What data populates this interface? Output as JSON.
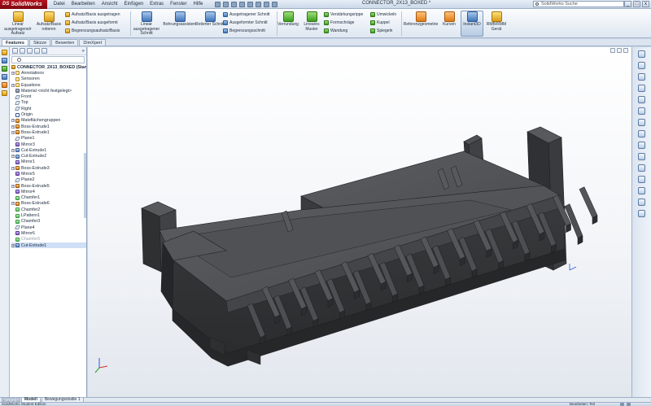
{
  "app": {
    "name": "SolidWorks",
    "doc_title": "CONNECTOR_2X13_BOXED *"
  },
  "menu": [
    "Datei",
    "Bearbeiten",
    "Ansicht",
    "Einfügen",
    "Extras",
    "Fenster",
    "Hilfe"
  ],
  "search": {
    "placeholder": "SolidWorks Suche"
  },
  "window_controls": {
    "minimize": "_",
    "restore": "□",
    "close": "x"
  },
  "ribbon": {
    "linear_boss": "Linear ausgetragene/r Aufsatz",
    "boss_revolve": "Aufsatz/Basis rotieren",
    "boss_swept": "Aufsatz/Basis ausgetragen",
    "boss_loft": "Aufsatz/Basis ausgeformt",
    "boss_boundary": "Begrenzungsaufsatz/Basis",
    "extruded_cut": "Linear ausgetragener Schnitt",
    "hole_wizard": "Bohrungsassistent",
    "revolved_cut": "Rotierter Schnitt",
    "swept_cut": "Ausgetragener Schnitt",
    "lofted_cut": "Ausgeformter Schnitt",
    "boundary_cut": "Begrenzungsschnitt",
    "fillet": "Verrundung",
    "linear_pattern": "Lineares Muster",
    "rib": "Verstärkungsrippe",
    "draft": "Formschräge",
    "shell": "Wandung",
    "wrap": "Umwickeln",
    "dome": "Kuppel",
    "mirror": "Spiegeln",
    "reference_geometry": "Referenzgeometrie",
    "curves": "Kurven",
    "instant3d": "Instant3D",
    "rmb_tools": "RMB/RMM Gerät"
  },
  "tabs": [
    "Features",
    "Skizze",
    "Bewerten",
    "DimXpert"
  ],
  "tree": {
    "root": "CONNECTOR_2X13_BOXED (Standard)",
    "items": [
      {
        "label": "Annotations",
        "icon": "annotations-icon",
        "exp": true
      },
      {
        "label": "Sensoren",
        "icon": "sensor-icon",
        "exp": false
      },
      {
        "label": "Equations",
        "icon": "equations-icon",
        "exp": true
      },
      {
        "label": "Material <nicht festgelegt>",
        "icon": "material-icon",
        "exp": false
      },
      {
        "label": "Front",
        "icon": "plane-icon",
        "exp": false
      },
      {
        "label": "Top",
        "icon": "plane-icon",
        "exp": false
      },
      {
        "label": "Right",
        "icon": "plane-icon",
        "exp": false
      },
      {
        "label": "Origin",
        "icon": "origin-icon",
        "exp": false
      },
      {
        "label": "Mateflächengruppen",
        "icon": "feature-icon",
        "exp": true
      },
      {
        "label": "Boss-Extrude1",
        "icon": "extrude-icon",
        "exp": true
      },
      {
        "label": "Boss-Extrude1",
        "icon": "extrude-icon",
        "exp": true
      },
      {
        "label": "Plane1",
        "icon": "plane-icon",
        "exp": false
      },
      {
        "label": "Mirror3",
        "icon": "mirror-icon",
        "exp": false
      },
      {
        "label": "Cut-Extrude1",
        "icon": "cut-icon",
        "exp": true
      },
      {
        "label": "Cut-Extrude2",
        "icon": "cut-icon",
        "exp": true
      },
      {
        "label": "Mirror1",
        "icon": "mirror-icon",
        "exp": false
      },
      {
        "label": "Boss-Extrude3",
        "icon": "extrude-icon",
        "exp": true
      },
      {
        "label": "Mirror5",
        "icon": "mirror-icon",
        "exp": false
      },
      {
        "label": "Plane2",
        "icon": "plane-icon",
        "exp": false
      },
      {
        "label": "Boss-Extrude5",
        "icon": "extrude-icon",
        "exp": true
      },
      {
        "label": "Mirror4",
        "icon": "mirror-icon",
        "exp": false
      },
      {
        "label": "Chamfer1",
        "icon": "chamfer-icon",
        "exp": false
      },
      {
        "label": "Boss-Extrude6",
        "icon": "extrude-icon",
        "exp": true
      },
      {
        "label": "Chamfer2",
        "icon": "chamfer-icon",
        "exp": false
      },
      {
        "label": "LPattern1",
        "icon": "pattern-icon",
        "exp": false
      },
      {
        "label": "Chamfer3",
        "icon": "chamfer-icon",
        "exp": false
      },
      {
        "label": "Plane4",
        "icon": "plane-icon",
        "exp": false
      },
      {
        "label": "Mirror6",
        "icon": "mirror-icon",
        "exp": false
      },
      {
        "label": "Chamfer5",
        "icon": "chamfer-icon",
        "exp": false,
        "suppressed": true
      },
      {
        "label": "Cut-Extrude1",
        "icon": "cut-icon",
        "exp": true,
        "selected": true
      }
    ]
  },
  "bottom_tabs": [
    "Modell",
    "Bewegungsstudie 1"
  ],
  "status": {
    "left": "SolidWorks Student Edition",
    "right": "Bearbeiten: Teil"
  },
  "colors": {
    "part": "#4a4b4d",
    "accent": "#3f74b8",
    "viewport_top": "#ffffff",
    "viewport_bottom": "#e2e7ee"
  }
}
